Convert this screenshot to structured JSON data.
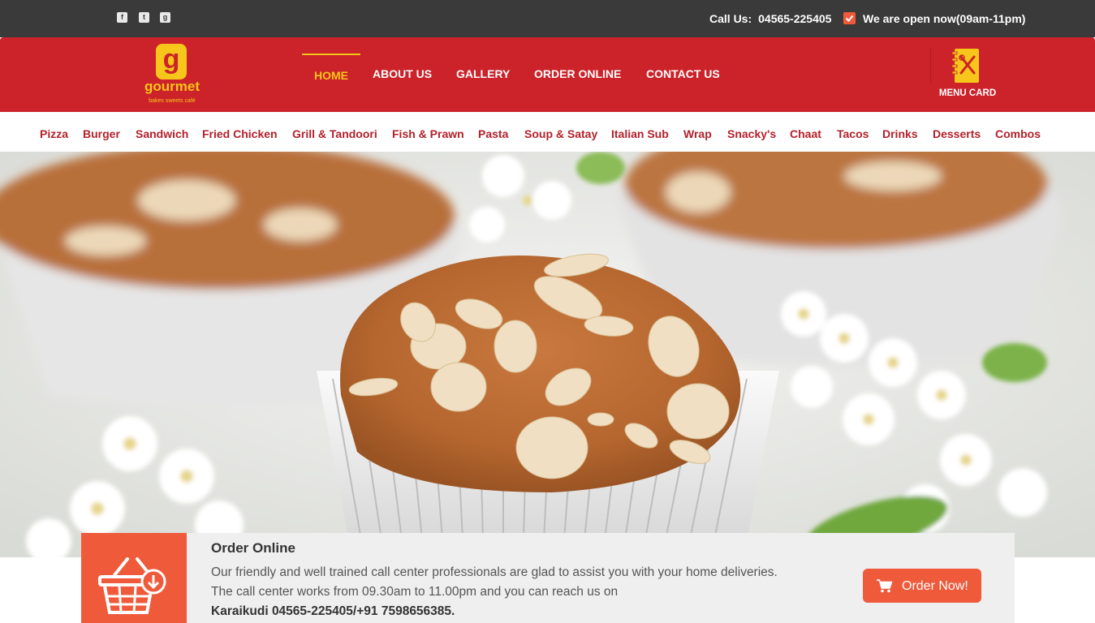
{
  "topbar": {
    "social": [
      {
        "name": "facebook-icon",
        "glyph": "f"
      },
      {
        "name": "twitter-icon",
        "glyph": "t"
      },
      {
        "name": "google-plus-icon",
        "glyph": "g"
      }
    ],
    "call_label": "Call Us:",
    "phone": "04565-225405",
    "open_status": "We are open now(09am-11pm)"
  },
  "header": {
    "logo": {
      "letter": "g",
      "word": "gourmet",
      "tagline": "bakes sweets café"
    },
    "nav": [
      {
        "label": "HOME"
      },
      {
        "label": "ABOUT US"
      },
      {
        "label": "GALLERY"
      },
      {
        "label": "ORDER ONLINE"
      },
      {
        "label": "CONTACT US"
      }
    ],
    "menu_card_label": "MENU CARD"
  },
  "categories": [
    "Pizza",
    "Burger",
    "Sandwich",
    "Fried Chicken",
    "Grill & Tandoori",
    "Fish & Prawn",
    "Pasta",
    "Soup & Satay",
    "Italian Sub",
    "Wrap",
    "Snacky's",
    "Chaat",
    "Tacos",
    "Drinks",
    "Desserts",
    "Combos"
  ],
  "order": {
    "title": "Order Online",
    "line1": "Our friendly and well trained call center professionals are glad to assist you with your home deliveries.",
    "line2": "The call center works from 09.30am to 11.00pm and you can reach us on",
    "line3": "Karaikudi 04565-225405/+91 7598656385.",
    "button": "Order Now!"
  },
  "colors": {
    "topbar": "#3a3a3a",
    "header_red": "#cc2229",
    "accent_yellow": "#f6c61a",
    "accent_orange": "#ef5a3b",
    "category_red": "#b3202a"
  }
}
